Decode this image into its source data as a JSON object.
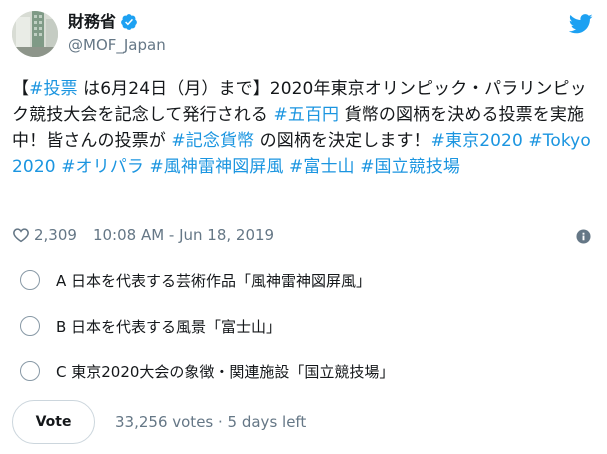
{
  "author": {
    "display_name": "財務省",
    "handle": "@MOF_Japan"
  },
  "tweet": {
    "segments": [
      {
        "text": "【",
        "tag": false
      },
      {
        "text": "#投票",
        "tag": true
      },
      {
        "text": " は6月24日（月）まで】2020年東京オリンピック・パラリンピック競技大会を記念して発行される ",
        "tag": false
      },
      {
        "text": "#五百円",
        "tag": true
      },
      {
        "text": " 貨幣の図柄を決める投票を実施中！皆さんの投票が ",
        "tag": false
      },
      {
        "text": "#記念貨幣",
        "tag": true
      },
      {
        "text": " の図柄を決定します！",
        "tag": false
      },
      {
        "text": "#東京2020",
        "tag": true
      },
      {
        "text": " ",
        "tag": false
      },
      {
        "text": "#Tokyo2020",
        "tag": true
      },
      {
        "text": " ",
        "tag": false
      },
      {
        "text": "#オリパラ",
        "tag": true
      },
      {
        "text": " ",
        "tag": false
      },
      {
        "text": "#風神雷神図屏風",
        "tag": true
      },
      {
        "text": " ",
        "tag": false
      },
      {
        "text": "#富士山",
        "tag": true
      },
      {
        "text": " ",
        "tag": false
      },
      {
        "text": "#国立競技場",
        "tag": true
      }
    ]
  },
  "meta": {
    "likes": "2,309",
    "timestamp": "10:08 AM - Jun 18, 2019"
  },
  "poll": {
    "options": [
      "A 日本を代表する芸術作品「風神雷神図屏風」",
      "B 日本を代表する風景「富士山」",
      "C 東京2020大会の象徴・関連施設「国立競技場」"
    ],
    "vote_label": "Vote",
    "votes_info": "33,256 votes · 5 days left"
  },
  "colors": {
    "link": "#1b95e0",
    "twitter_blue": "#1da1f2",
    "muted": "#657786"
  }
}
